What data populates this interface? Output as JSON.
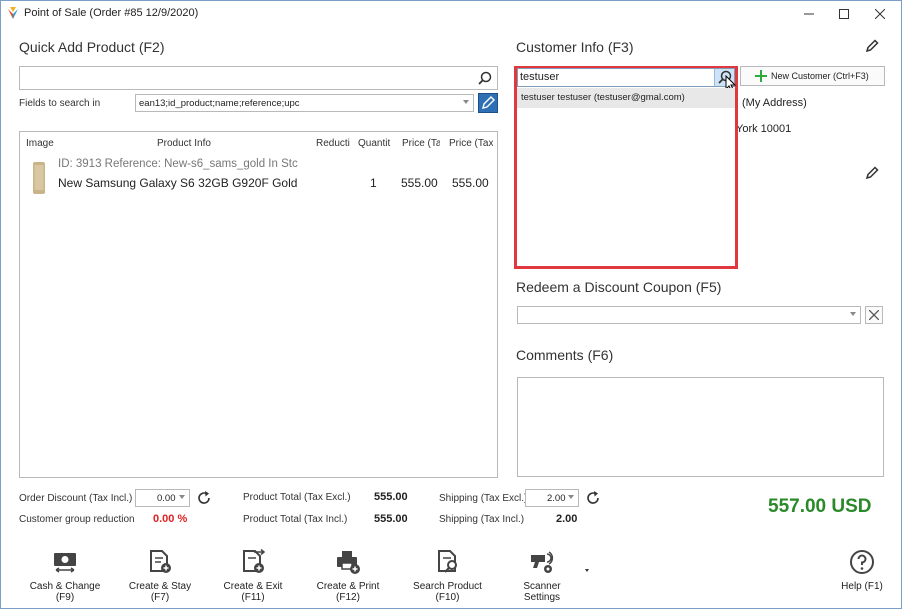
{
  "window": {
    "title": "Point of Sale (Order #85 12/9/2020)"
  },
  "quick_add": {
    "title": "Quick Add Product (F2)",
    "search_value": "",
    "fields_label": "Fields to search in",
    "fields_value": "ean13;id_product;name;reference;upc"
  },
  "grid": {
    "columns": [
      "Image",
      "Product Info",
      "Reducti",
      "Quantit",
      "Price (Tax",
      "Price (Tax I"
    ],
    "rows": [
      {
        "info_line1": "ID: 3913 Reference: New-s6_sams_gold In Stc",
        "info_line2": "New Samsung Galaxy S6 32GB G920F Gold",
        "reduction": "",
        "quantity": "1",
        "price_excl": "555.00",
        "price_incl": "555.00"
      }
    ]
  },
  "customer": {
    "title": "Customer Info (F3)",
    "search_value": "testuser",
    "new_customer_label": "New Customer (Ctrl+F3)",
    "address_label": "(My Address)",
    "address_line": "York 10001",
    "suggestion": "testuser testuser (testuser@gmal.com)"
  },
  "coupon": {
    "title": "Redeem a Discount Coupon (F5)",
    "value": ""
  },
  "comments": {
    "title": "Comments (F6)",
    "value": ""
  },
  "totals": {
    "order_discount_label": "Order Discount (Tax Incl.)",
    "order_discount_value": "0.00",
    "group_reduction_label": "Customer group reduction",
    "group_reduction_value": "0.00 %",
    "product_total_excl_label": "Product Total (Tax Excl.)",
    "product_total_excl_value": "555.00",
    "product_total_incl_label": "Product Total (Tax Incl.)",
    "product_total_incl_value": "555.00",
    "shipping_excl_label": "Shipping (Tax Excl.)",
    "shipping_excl_value": "2.00",
    "shipping_incl_label": "Shipping (Tax Incl.)",
    "shipping_incl_value": "2.00",
    "grand_total": "557.00 USD"
  },
  "toolbar": {
    "cash_change": "Cash & Change (F9)",
    "create_stay": "Create & Stay (F7)",
    "create_exit": "Create & Exit (F11)",
    "create_print": "Create & Print (F12)",
    "search_product": "Search Product (F10)",
    "scanner_settings": "Scanner Settings",
    "help": "Help (F1)"
  },
  "colors": {
    "grand_total": "#2a8a2a",
    "group_reduction": "#e02020",
    "highlight_box": "#e0383e",
    "new_customer_plus": "#2eaa3a"
  }
}
